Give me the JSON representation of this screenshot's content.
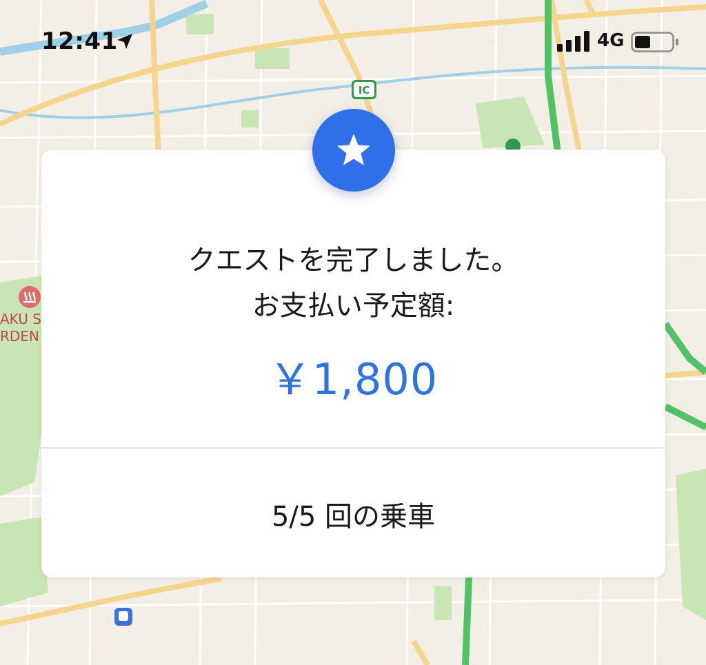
{
  "status_bar": {
    "time": "12:41",
    "network": "4G",
    "icons": [
      "location-arrow-icon",
      "signal-bars-icon",
      "battery-icon"
    ]
  },
  "map": {
    "interchange_label": "IC",
    "partial_place_labels": [
      "AKU S",
      "RDEN"
    ]
  },
  "quest_card": {
    "badge_icon": "star-icon",
    "message_line1": "クエストを完了しました。",
    "message_line2": "お支払い予定額:",
    "amount": "￥1,800",
    "rides_progress": "5/5 回の乗車"
  },
  "colors": {
    "accent_blue": "#2f6fe9",
    "amount_blue": "#2f73de",
    "map_background": "#f3efe6",
    "road_yellow": "#f4d58c",
    "highway_green": "#52c267",
    "park_green": "#c9e5b3",
    "water_blue": "#9fd0e8"
  }
}
